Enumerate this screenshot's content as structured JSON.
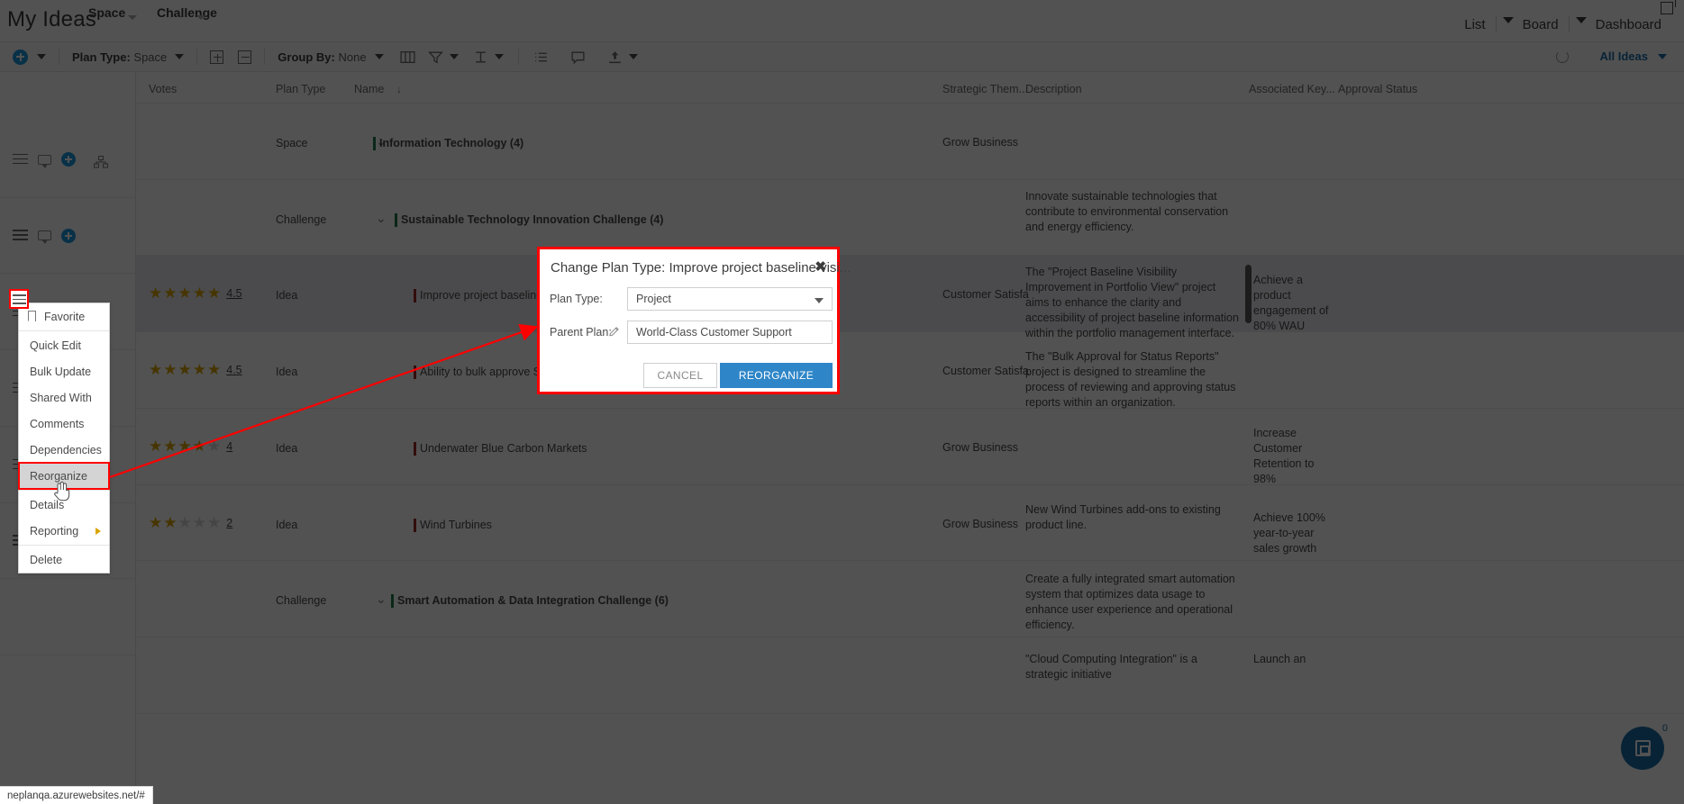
{
  "header": {
    "app_title": "My Ideas",
    "breadcrumbs": [
      {
        "label": "Space",
        "icon": "chevron-down-icon"
      },
      {
        "label": "Challenge",
        "icon": "chevron-down-icon"
      }
    ],
    "nav": [
      {
        "label": "List",
        "active": true,
        "has_caret": true
      },
      {
        "label": "Board",
        "active": false,
        "has_caret": true
      },
      {
        "label": "Dashboard",
        "active": false,
        "has_caret": false
      }
    ],
    "popout_icon": "popout-icon"
  },
  "toolbar": {
    "add_icon": "plus-circle-icon",
    "add_caret_icon": "chevron-down-icon",
    "plan_type_label": "Plan Type:",
    "plan_type_value": "Space",
    "plan_type_caret_icon": "chevron-down-icon",
    "expand_icon": "expand-all-icon",
    "collapse_icon": "collapse-all-icon",
    "group_by_label": "Group By:",
    "group_by_value": "None",
    "group_by_caret_icon": "chevron-down-icon",
    "columns_icon": "columns-icon",
    "filter_icon": "filter-icon",
    "filter_caret_icon": "chevron-down-icon",
    "text_size_icon": "text-size-icon",
    "text_size_caret_icon": "chevron-down-icon",
    "list_icon": "list-icon",
    "comment_icon": "comment-icon",
    "export_icon": "export-icon",
    "export_caret_icon": "chevron-down-icon",
    "refresh_icon": "refresh-icon",
    "view_filter_label": "All Ideas",
    "view_filter_caret_icon": "chevron-down-icon"
  },
  "grid": {
    "columns": [
      {
        "key": "votes",
        "label": "Votes"
      },
      {
        "key": "plan_type",
        "label": "Plan Type",
        "sorted": true,
        "sort_icon": "sort-desc-icon"
      },
      {
        "key": "name",
        "label": "Name"
      },
      {
        "key": "strategic_theme",
        "label": "Strategic Them..."
      },
      {
        "key": "description",
        "label": "Description"
      },
      {
        "key": "associated_key",
        "label": "Associated Key..."
      },
      {
        "key": "approval_status",
        "label": "Approval Status"
      }
    ],
    "rows": [
      {
        "type": "group",
        "plan_type": "Space",
        "name": "Information Technology (4)",
        "caret_icon": "chevron-down-icon",
        "bar_color": "green",
        "strategic_theme": "Grow Business",
        "description": "",
        "associated_key": ""
      },
      {
        "type": "group",
        "plan_type": "Challenge",
        "name": "Sustainable Technology Innovation Challenge (4)",
        "caret_icon": "chevron-down-icon",
        "bar_color": "green",
        "strategic_theme": "",
        "description": "Innovate sustainable technologies that contribute to environmental conservation and energy efficiency.",
        "associated_key": ""
      },
      {
        "type": "idea",
        "votes_filled": 5,
        "votes_score": "4.5",
        "plan_type": "Idea",
        "name": "Improve project baseline v",
        "bar_color": "red",
        "strategic_theme": "Customer Satisfa",
        "description": "The \"Project Baseline Visibility Improvement in Portfolio View\" project aims to enhance the clarity and accessibility of project baseline information within the portfolio management interface.",
        "associated_key": "Achieve a product engagement of 80% WAU",
        "selected": true
      },
      {
        "type": "idea",
        "votes_filled": 5,
        "votes_score": "4.5",
        "plan_type": "Idea",
        "name": "Ability to bulk approve Sta",
        "bar_color": "red",
        "strategic_theme": "Customer Satisfa",
        "description": "The \"Bulk Approval for Status Reports\" project is designed to streamline the process of reviewing and approving status reports within an organization.",
        "associated_key": "",
        "selected": false
      },
      {
        "type": "idea",
        "votes_filled": 4,
        "votes_score": "4",
        "plan_type": "Idea",
        "name": "Underwater Blue Carbon Markets",
        "bar_color": "red",
        "strategic_theme": "Grow Business",
        "description": "",
        "associated_key": "Increase Customer Retention to 98%",
        "selected": false
      },
      {
        "type": "idea",
        "votes_filled": 2,
        "votes_score": "2",
        "plan_type": "Idea",
        "name": "Wind Turbines",
        "bar_color": "red",
        "strategic_theme": "Grow Business",
        "description": "New Wind Turbines add-ons to existing product line.",
        "associated_key": "Achieve 100% year-to-year sales growth",
        "selected": false
      },
      {
        "type": "group",
        "plan_type": "Challenge",
        "name": "Smart Automation & Data Integration Challenge (6)",
        "caret_icon": "chevron-down-icon",
        "bar_color": "green",
        "strategic_theme": "",
        "description": "Create a fully integrated smart automation system that optimizes data usage to enhance user experience and operational efficiency.",
        "associated_key": ""
      },
      {
        "type": "partial",
        "plan_type": "",
        "name": "",
        "bar_color": "",
        "strategic_theme": "",
        "description": "\"Cloud Computing Integration\" is a strategic initiative",
        "associated_key": "Launch an"
      }
    ]
  },
  "context_menu": {
    "items": [
      {
        "label": "Favorite",
        "icon": "bookmark-icon",
        "highlighted": false,
        "divider_after": true
      },
      {
        "label": "Quick Edit",
        "icon": null,
        "highlighted": false
      },
      {
        "label": "Bulk Update",
        "icon": null,
        "highlighted": false
      },
      {
        "label": "Shared With",
        "icon": null,
        "highlighted": false
      },
      {
        "label": "Comments",
        "icon": null,
        "highlighted": false
      },
      {
        "label": "Dependencies",
        "icon": null,
        "highlighted": false
      },
      {
        "label": "Reorganize",
        "icon": null,
        "highlighted": true,
        "divider_after": true
      },
      {
        "label": "Details",
        "icon": null,
        "highlighted": false
      },
      {
        "label": "Reporting",
        "icon": null,
        "highlighted": false,
        "submenu_icon": "submenu-arrow-icon",
        "divider_after": true
      },
      {
        "label": "Delete",
        "icon": null,
        "highlighted": false
      }
    ]
  },
  "modal": {
    "title": "Change Plan Type: Improve project baseline visi...",
    "close_icon": "close-icon",
    "plan_type_label": "Plan Type:",
    "plan_type_value": "Project",
    "plan_type_caret_icon": "chevron-down-icon",
    "parent_plan_label": "Parent Plan:",
    "parent_plan_edit_icon": "pencil-icon",
    "parent_plan_value": "World-Class Customer Support",
    "cancel_label": "CANCEL",
    "submit_label": "REORGANIZE"
  },
  "fab": {
    "icon": "assistant-icon",
    "badge": "0"
  },
  "status_bar": {
    "url": "neplanqa.azurewebsites.net/#"
  },
  "colors": {
    "accent": "#1a6ea8",
    "primary_button": "#2e86c8",
    "add_blue": "#1b9ae0",
    "highlight_red": "#ff0000",
    "star_gold": "#d9a400",
    "group_bar_green": "#1f7a4d",
    "idea_bar_red": "#9e2a2a"
  }
}
